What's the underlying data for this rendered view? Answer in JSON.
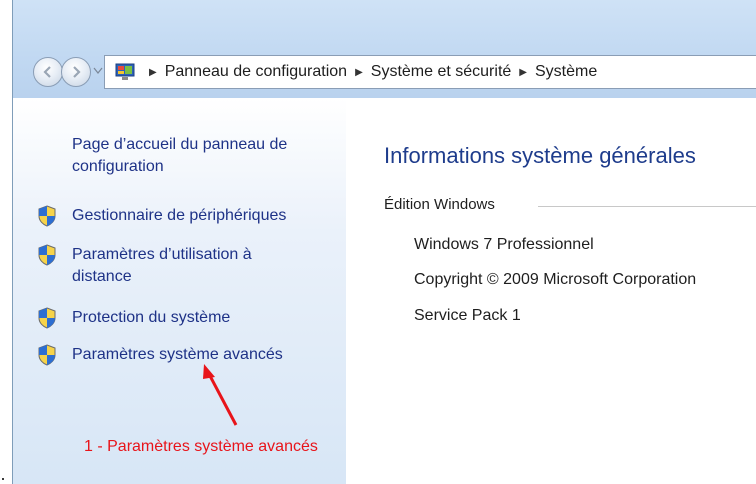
{
  "address_bar": {
    "icon": "control-panel-icon",
    "breadcrumbs": [
      "Panneau de configuration",
      "Système et sécurité",
      "Système"
    ]
  },
  "sidebar": {
    "home_link": "Page d’accueil du panneau de configuration",
    "tasks": [
      {
        "label": "Gestionnaire de périphériques",
        "icon": "uac-shield-icon"
      },
      {
        "label": "Paramètres d’utilisation à distance",
        "icon": "uac-shield-icon"
      },
      {
        "label": "Protection du système",
        "icon": "uac-shield-icon"
      },
      {
        "label": "Paramètres système avancés",
        "icon": "uac-shield-icon"
      }
    ]
  },
  "main": {
    "heading": "Informations système générales",
    "section_title": "Édition Windows",
    "lines": [
      "Windows 7 Professionnel",
      "Copyright © 2009 Microsoft Corporation",
      "Service Pack 1"
    ]
  },
  "annotation": {
    "text": "1 - Paramètres système avancés",
    "color": "#e8141a"
  },
  "colors": {
    "link": "#1e3287",
    "heading": "#1e3c8c",
    "titlebar": "#c2d9f2"
  }
}
